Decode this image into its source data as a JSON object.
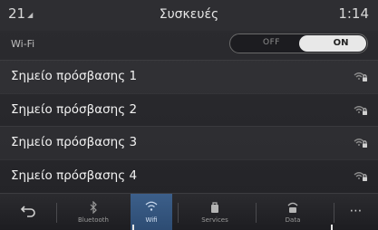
{
  "header": {
    "source": "21",
    "title": "Συσκευές",
    "time": "1:14"
  },
  "wifi": {
    "label": "Wi-Fi",
    "off_label": "OFF",
    "on_label": "ON",
    "state": "on"
  },
  "access_points": [
    {
      "label": "Σημείο πρόσβασης 1",
      "icon": "wifi-lock-icon"
    },
    {
      "label": "Σημείο πρόσβασης 2",
      "icon": "wifi-lock-icon"
    },
    {
      "label": "Σημείο πρόσβασης 3",
      "icon": "wifi-lock-icon"
    },
    {
      "label": "Σημείο πρόσβασης 4",
      "icon": "wifi-lock-icon"
    }
  ],
  "bottom_nav": {
    "back_icon": "back-arrow-icon",
    "items": [
      {
        "label": "Bluetooth",
        "icon": "bluetooth-icon"
      },
      {
        "label": "Wifi",
        "icon": "wifi-icon",
        "active": true
      },
      {
        "label": "Services",
        "icon": "services-icon"
      },
      {
        "label": "Data",
        "icon": "data-icon"
      }
    ],
    "more_icon": "more-icon"
  },
  "colors": {
    "active_tab": "#3c5f8a",
    "background": "#2a2a2e"
  }
}
